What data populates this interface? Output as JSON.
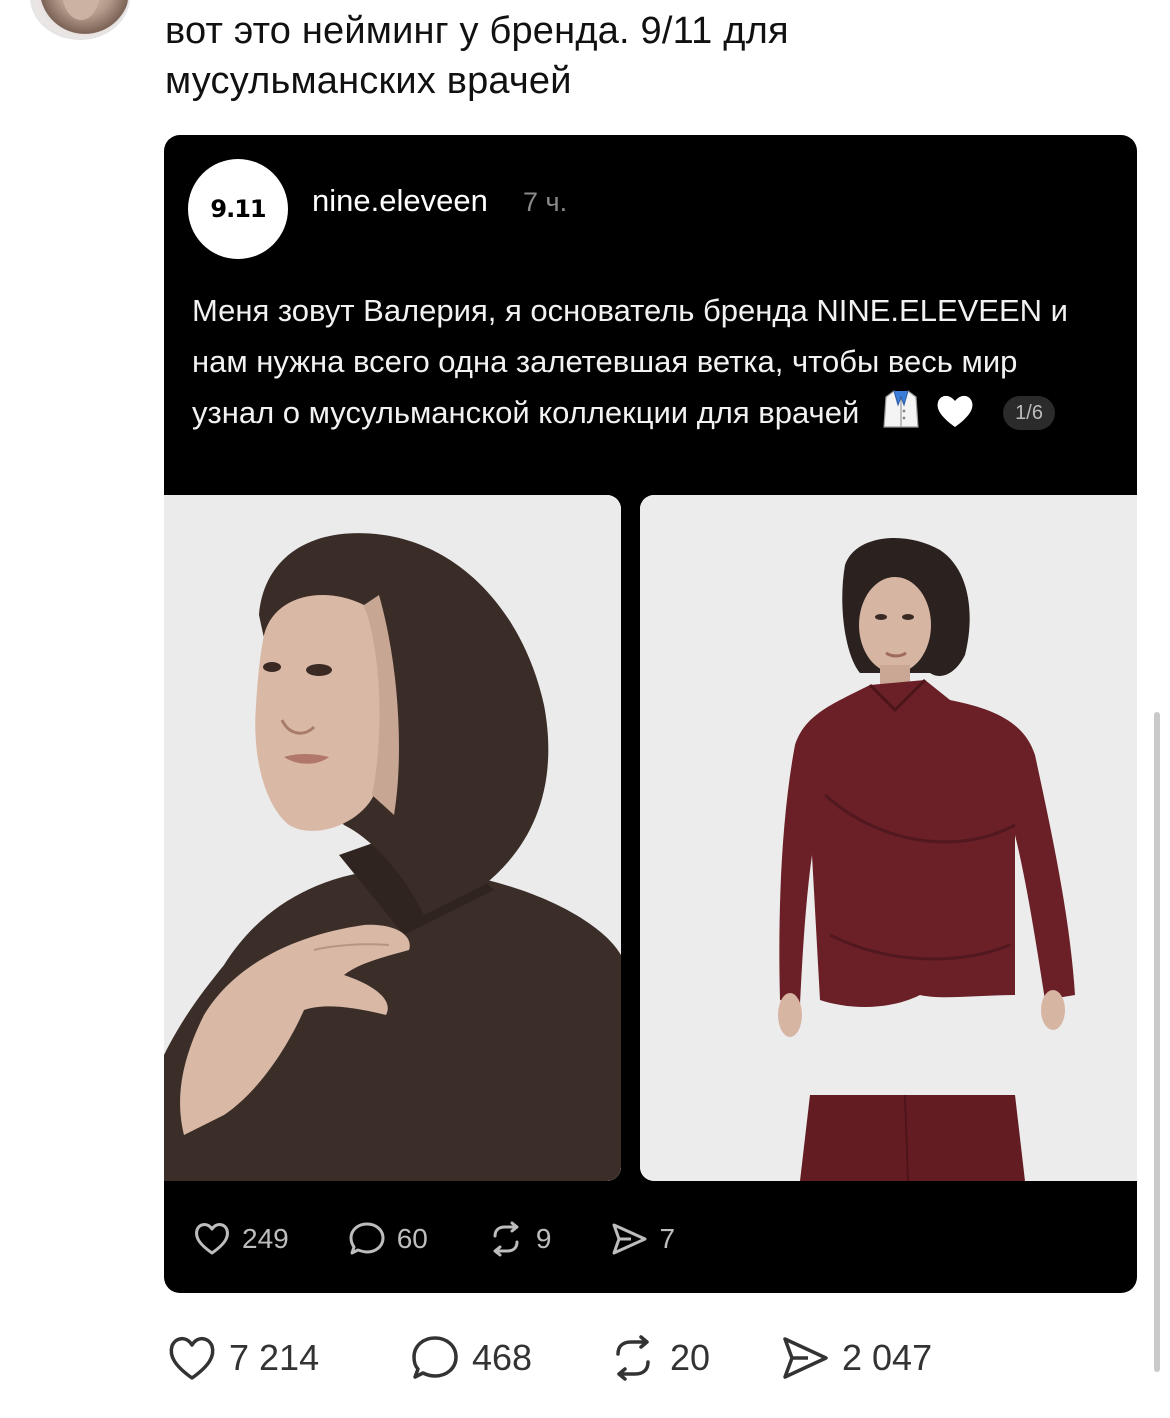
{
  "post": {
    "text": "вот это нейминг у бренда. 9/11 для мусульманских врачей"
  },
  "quoted": {
    "logo_text": "9.11",
    "handle": "nine.eleveen",
    "time": "7 ч.",
    "text": "Меня зовут Валерия, я основатель бренда NINE.ELEVEEN и нам нужна всего одна залетевшая ветка, чтобы весь мир узнал о мусульманской коллекции для врачей",
    "emojis": [
      "lab-coat-icon",
      "white-heart-icon"
    ],
    "pager": "1/6",
    "stats": {
      "likes": "249",
      "replies": "60",
      "reposts": "9",
      "shares": "7"
    }
  },
  "stats": {
    "likes": "7 214",
    "replies": "468",
    "reposts": "20",
    "shares": "2 047"
  },
  "colors": {
    "card_bg": "#000000",
    "hijab_brown": "#3a2c26",
    "suit_burgundy": "#6b1f26",
    "photo_bg": "#eeeeee"
  }
}
